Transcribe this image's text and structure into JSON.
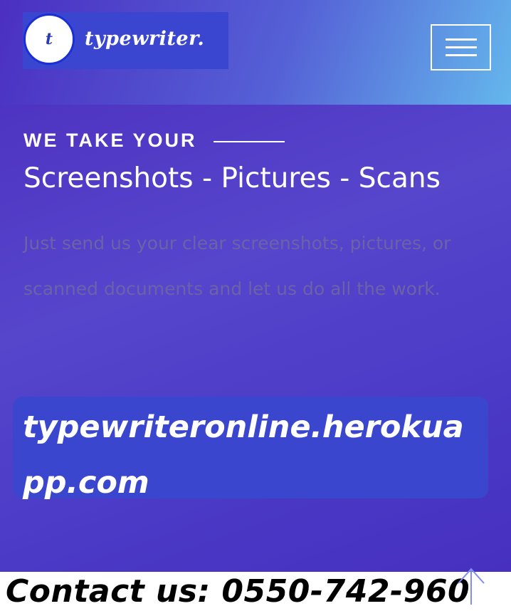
{
  "logo": {
    "initial": "t",
    "name": "typewriter."
  },
  "header": {
    "menu_icon": "hamburger-menu-icon"
  },
  "hero": {
    "kicker": "WE TAKE YOUR",
    "headline": "Screenshots - Pictures - Scans",
    "body": "Just send us your clear screenshots, pictures, or scanned documents and let us do all the work."
  },
  "url_banner": {
    "text": "typewriteronline.herokuapp.com"
  },
  "contact": {
    "text": "Contact us: 0550-742-960"
  },
  "scroll_top": {
    "icon": "arrow-up-icon"
  },
  "colors": {
    "accent": "#3b46cf",
    "background": "#5646cc",
    "body_text": "#6b62a8"
  }
}
